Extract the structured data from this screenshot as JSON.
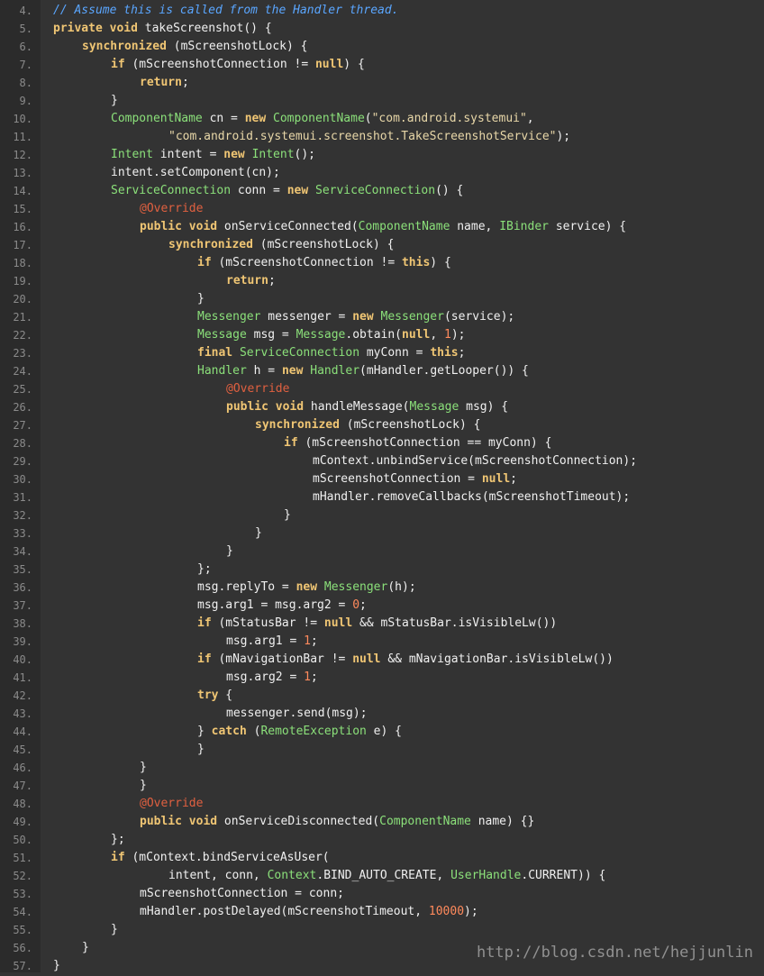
{
  "watermark": "http://blog.csdn.net/hejjunlin",
  "lines": [
    {
      "n": "4.",
      "ind": 0,
      "t": [
        [
          "c",
          "// Assume this is called from the Handler thread."
        ]
      ]
    },
    {
      "n": "5.",
      "ind": 0,
      "t": [
        [
          "k",
          "private"
        ],
        [
          "p",
          " "
        ],
        [
          "k",
          "void"
        ],
        [
          "p",
          " takeScreenshot() {"
        ]
      ]
    },
    {
      "n": "6.",
      "ind": 1,
      "t": [
        [
          "k",
          "synchronized"
        ],
        [
          "p",
          " (mScreenshotLock) {"
        ]
      ]
    },
    {
      "n": "7.",
      "ind": 2,
      "t": [
        [
          "k",
          "if"
        ],
        [
          "p",
          " (mScreenshotConnection != "
        ],
        [
          "k",
          "null"
        ],
        [
          "p",
          ") {"
        ]
      ]
    },
    {
      "n": "8.",
      "ind": 3,
      "t": [
        [
          "k",
          "return"
        ],
        [
          "p",
          ";"
        ]
      ]
    },
    {
      "n": "9.",
      "ind": 2,
      "t": [
        [
          "p",
          "}"
        ]
      ]
    },
    {
      "n": "10.",
      "ind": 2,
      "t": [
        [
          "t",
          "ComponentName"
        ],
        [
          "p",
          " cn = "
        ],
        [
          "k",
          "new"
        ],
        [
          "p",
          " "
        ],
        [
          "t",
          "ComponentName"
        ],
        [
          "p",
          "("
        ],
        [
          "s",
          "\"com.android.systemui\""
        ],
        [
          "p",
          ","
        ]
      ]
    },
    {
      "n": "11.",
      "ind": 4,
      "t": [
        [
          "s",
          "\"com.android.systemui.screenshot.TakeScreenshotService\""
        ],
        [
          "p",
          ");"
        ]
      ]
    },
    {
      "n": "12.",
      "ind": 2,
      "t": [
        [
          "t",
          "Intent"
        ],
        [
          "p",
          " intent = "
        ],
        [
          "k",
          "new"
        ],
        [
          "p",
          " "
        ],
        [
          "t",
          "Intent"
        ],
        [
          "p",
          "();"
        ]
      ]
    },
    {
      "n": "13.",
      "ind": 2,
      "t": [
        [
          "p",
          "intent.setComponent(cn);"
        ]
      ]
    },
    {
      "n": "14.",
      "ind": 2,
      "t": [
        [
          "t",
          "ServiceConnection"
        ],
        [
          "p",
          " conn = "
        ],
        [
          "k",
          "new"
        ],
        [
          "p",
          " "
        ],
        [
          "t",
          "ServiceConnection"
        ],
        [
          "p",
          "() {"
        ]
      ]
    },
    {
      "n": "15.",
      "ind": 3,
      "t": [
        [
          "a",
          "@Override"
        ]
      ]
    },
    {
      "n": "16.",
      "ind": 3,
      "t": [
        [
          "k",
          "public"
        ],
        [
          "p",
          " "
        ],
        [
          "k",
          "void"
        ],
        [
          "p",
          " onServiceConnected("
        ],
        [
          "t",
          "ComponentName"
        ],
        [
          "p",
          " name, "
        ],
        [
          "t",
          "IBinder"
        ],
        [
          "p",
          " service) {"
        ]
      ]
    },
    {
      "n": "17.",
      "ind": 4,
      "t": [
        [
          "k",
          "synchronized"
        ],
        [
          "p",
          " (mScreenshotLock) {"
        ]
      ]
    },
    {
      "n": "18.",
      "ind": 5,
      "t": [
        [
          "k",
          "if"
        ],
        [
          "p",
          " (mScreenshotConnection != "
        ],
        [
          "k",
          "this"
        ],
        [
          "p",
          ") {"
        ]
      ]
    },
    {
      "n": "19.",
      "ind": 6,
      "t": [
        [
          "k",
          "return"
        ],
        [
          "p",
          ";"
        ]
      ]
    },
    {
      "n": "20.",
      "ind": 5,
      "t": [
        [
          "p",
          "}"
        ]
      ]
    },
    {
      "n": "21.",
      "ind": 5,
      "t": [
        [
          "t",
          "Messenger"
        ],
        [
          "p",
          " messenger = "
        ],
        [
          "k",
          "new"
        ],
        [
          "p",
          " "
        ],
        [
          "t",
          "Messenger"
        ],
        [
          "p",
          "(service);"
        ]
      ]
    },
    {
      "n": "22.",
      "ind": 5,
      "t": [
        [
          "t",
          "Message"
        ],
        [
          "p",
          " msg = "
        ],
        [
          "t",
          "Message"
        ],
        [
          "p",
          ".obtain("
        ],
        [
          "k",
          "null"
        ],
        [
          "p",
          ", "
        ],
        [
          "n",
          "1"
        ],
        [
          "p",
          ");"
        ]
      ]
    },
    {
      "n": "23.",
      "ind": 5,
      "t": [
        [
          "k",
          "final"
        ],
        [
          "p",
          " "
        ],
        [
          "t",
          "ServiceConnection"
        ],
        [
          "p",
          " myConn = "
        ],
        [
          "k",
          "this"
        ],
        [
          "p",
          ";"
        ]
      ]
    },
    {
      "n": "24.",
      "ind": 5,
      "t": [
        [
          "t",
          "Handler"
        ],
        [
          "p",
          " h = "
        ],
        [
          "k",
          "new"
        ],
        [
          "p",
          " "
        ],
        [
          "t",
          "Handler"
        ],
        [
          "p",
          "(mHandler.getLooper()) {"
        ]
      ]
    },
    {
      "n": "25.",
      "ind": 6,
      "t": [
        [
          "a",
          "@Override"
        ]
      ]
    },
    {
      "n": "26.",
      "ind": 6,
      "t": [
        [
          "k",
          "public"
        ],
        [
          "p",
          " "
        ],
        [
          "k",
          "void"
        ],
        [
          "p",
          " handleMessage("
        ],
        [
          "t",
          "Message"
        ],
        [
          "p",
          " msg) {"
        ]
      ]
    },
    {
      "n": "27.",
      "ind": 7,
      "t": [
        [
          "k",
          "synchronized"
        ],
        [
          "p",
          " (mScreenshotLock) {"
        ]
      ]
    },
    {
      "n": "28.",
      "ind": 8,
      "t": [
        [
          "k",
          "if"
        ],
        [
          "p",
          " (mScreenshotConnection == myConn) {"
        ]
      ]
    },
    {
      "n": "29.",
      "ind": 9,
      "t": [
        [
          "p",
          "mContext.unbindService(mScreenshotConnection);"
        ]
      ]
    },
    {
      "n": "30.",
      "ind": 9,
      "t": [
        [
          "p",
          "mScreenshotConnection = "
        ],
        [
          "k",
          "null"
        ],
        [
          "p",
          ";"
        ]
      ]
    },
    {
      "n": "31.",
      "ind": 9,
      "t": [
        [
          "p",
          "mHandler.removeCallbacks(mScreenshotTimeout);"
        ]
      ]
    },
    {
      "n": "32.",
      "ind": 8,
      "t": [
        [
          "p",
          "}"
        ]
      ]
    },
    {
      "n": "33.",
      "ind": 7,
      "t": [
        [
          "p",
          "}"
        ]
      ]
    },
    {
      "n": "34.",
      "ind": 6,
      "t": [
        [
          "p",
          "}"
        ]
      ]
    },
    {
      "n": "35.",
      "ind": 5,
      "t": [
        [
          "p",
          "};"
        ]
      ]
    },
    {
      "n": "36.",
      "ind": 5,
      "t": [
        [
          "p",
          "msg.replyTo = "
        ],
        [
          "k",
          "new"
        ],
        [
          "p",
          " "
        ],
        [
          "t",
          "Messenger"
        ],
        [
          "p",
          "(h);"
        ]
      ]
    },
    {
      "n": "37.",
      "ind": 5,
      "t": [
        [
          "p",
          "msg.arg1 = msg.arg2 = "
        ],
        [
          "n",
          "0"
        ],
        [
          "p",
          ";"
        ]
      ]
    },
    {
      "n": "38.",
      "ind": 5,
      "t": [
        [
          "k",
          "if"
        ],
        [
          "p",
          " (mStatusBar != "
        ],
        [
          "k",
          "null"
        ],
        [
          "p",
          " && mStatusBar.isVisibleLw())"
        ]
      ]
    },
    {
      "n": "39.",
      "ind": 6,
      "t": [
        [
          "p",
          "msg.arg1 = "
        ],
        [
          "n",
          "1"
        ],
        [
          "p",
          ";"
        ]
      ]
    },
    {
      "n": "40.",
      "ind": 5,
      "t": [
        [
          "k",
          "if"
        ],
        [
          "p",
          " (mNavigationBar != "
        ],
        [
          "k",
          "null"
        ],
        [
          "p",
          " && mNavigationBar.isVisibleLw())"
        ]
      ]
    },
    {
      "n": "41.",
      "ind": 6,
      "t": [
        [
          "p",
          "msg.arg2 = "
        ],
        [
          "n",
          "1"
        ],
        [
          "p",
          ";"
        ]
      ]
    },
    {
      "n": "42.",
      "ind": 5,
      "t": [
        [
          "k",
          "try"
        ],
        [
          "p",
          " {"
        ]
      ]
    },
    {
      "n": "43.",
      "ind": 6,
      "t": [
        [
          "p",
          "messenger.send(msg);"
        ]
      ]
    },
    {
      "n": "44.",
      "ind": 5,
      "t": [
        [
          "p",
          "} "
        ],
        [
          "k",
          "catch"
        ],
        [
          "p",
          " ("
        ],
        [
          "t",
          "RemoteException"
        ],
        [
          "p",
          " e) {"
        ]
      ]
    },
    {
      "n": "45.",
      "ind": 5,
      "t": [
        [
          "p",
          "}"
        ]
      ]
    },
    {
      "n": "46.",
      "ind": 3,
      "t": [
        [
          "p",
          "}"
        ]
      ]
    },
    {
      "n": "47.",
      "ind": 3,
      "t": [
        [
          "p",
          "}"
        ]
      ]
    },
    {
      "n": "48.",
      "ind": 3,
      "t": [
        [
          "a",
          "@Override"
        ]
      ]
    },
    {
      "n": "49.",
      "ind": 3,
      "t": [
        [
          "k",
          "public"
        ],
        [
          "p",
          " "
        ],
        [
          "k",
          "void"
        ],
        [
          "p",
          " onServiceDisconnected("
        ],
        [
          "t",
          "ComponentName"
        ],
        [
          "p",
          " name) {}"
        ]
      ]
    },
    {
      "n": "50.",
      "ind": 2,
      "t": [
        [
          "p",
          "};"
        ]
      ]
    },
    {
      "n": "51.",
      "ind": 2,
      "t": [
        [
          "k",
          "if"
        ],
        [
          "p",
          " (mContext.bindServiceAsUser("
        ]
      ]
    },
    {
      "n": "52.",
      "ind": 4,
      "t": [
        [
          "p",
          "intent, conn, "
        ],
        [
          "t",
          "Context"
        ],
        [
          "p",
          ".BIND_AUTO_CREATE, "
        ],
        [
          "t",
          "UserHandle"
        ],
        [
          "p",
          ".CURRENT)) {"
        ]
      ]
    },
    {
      "n": "53.",
      "ind": 3,
      "t": [
        [
          "p",
          "mScreenshotConnection = conn;"
        ]
      ]
    },
    {
      "n": "54.",
      "ind": 3,
      "t": [
        [
          "p",
          "mHandler.postDelayed(mScreenshotTimeout, "
        ],
        [
          "n",
          "10000"
        ],
        [
          "p",
          ");"
        ]
      ]
    },
    {
      "n": "55.",
      "ind": 2,
      "t": [
        [
          "p",
          "}"
        ]
      ]
    },
    {
      "n": "56.",
      "ind": 1,
      "t": [
        [
          "p",
          "}"
        ]
      ]
    },
    {
      "n": "57.",
      "ind": 0,
      "t": [
        [
          "p",
          "}"
        ]
      ]
    }
  ]
}
